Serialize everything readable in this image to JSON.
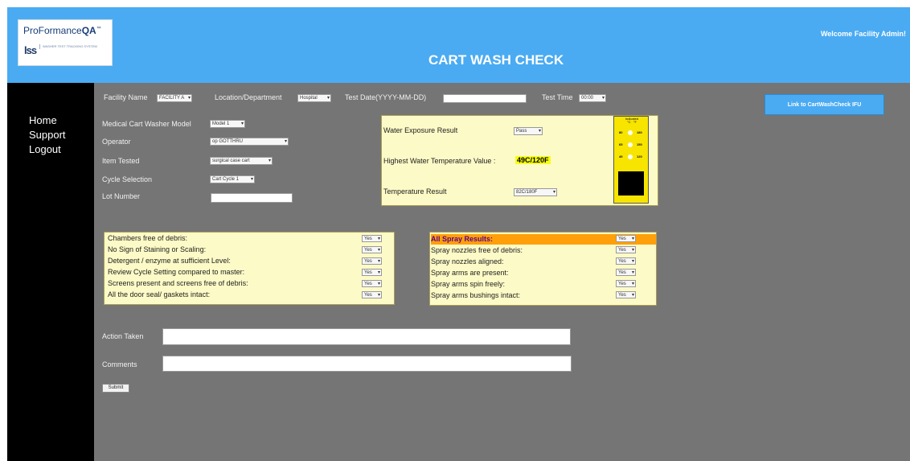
{
  "header": {
    "logo_brand_plain": "ProFormance",
    "logo_brand_bold": "QA",
    "logo_tm": "™",
    "logo_mark": "lss",
    "logo_sub": "WASHER TEST TRACKING SYSTEM",
    "title": "CART WASH CHECK",
    "welcome": "Welcome Facility Admin!"
  },
  "nav": [
    "Home",
    "Support",
    "Logout"
  ],
  "link_button": "Link to CartWashCheck IFU",
  "top_fields": {
    "facility_label": "Facility Name",
    "facility_value": "FACILITY A",
    "location_label": "Location/Department",
    "location_value": "Hospital",
    "date_label": "Test Date(YYYY-MM-DD)",
    "date_value": "",
    "time_label": "Test Time",
    "time_value": "00:00"
  },
  "left_fields": {
    "model_label": "Medical Cart Washer Model",
    "model_value": "Model 1",
    "operator_label": "Operator",
    "operator_value": "op GOTTHRU",
    "item_label": "Item Tested",
    "item_value": "surgical case cart",
    "cycle_label": "Cycle Selection",
    "cycle_value": "Cart Cycle 1",
    "lot_label": "Lot Number",
    "lot_value": ""
  },
  "water_panel": {
    "exposure_label": "Water Exposure Result",
    "exposure_value": "Pass",
    "temp_label": "Highest Water Temperature Value :",
    "temp_value": "49C/120F",
    "temp_result_label": "Temperature Result",
    "temp_result_value": "82C/180F",
    "gauge_header": "Indicated\n°C   °F",
    "gauge_rows": [
      {
        "c": "80",
        "f": "180"
      },
      {
        "c": "65",
        "f": "150"
      },
      {
        "c": "49",
        "f": "120"
      }
    ]
  },
  "checklist": [
    {
      "label": "Chambers free of debris:",
      "value": "Yes"
    },
    {
      "label": "No Sign of Staining or Scaling:",
      "value": "Yes"
    },
    {
      "label": "Detergent / enzyme at sufficient Level:",
      "value": "Yes"
    },
    {
      "label": "Review Cycle Setting compared to master:",
      "value": "Yes"
    },
    {
      "label": "Screens present and screens free of debris:",
      "value": "Yes"
    },
    {
      "label": "All the door seal/ gaskets intact:",
      "value": "Yes"
    }
  ],
  "spray": {
    "header_label": "All Spray Results:",
    "header_value": "Yes",
    "items": [
      {
        "label": "Spray nozzles free of debris:",
        "value": "Yes"
      },
      {
        "label": "Spray nozzles aligned:",
        "value": "Yes"
      },
      {
        "label": "Spray arms are present:",
        "value": "Yes"
      },
      {
        "label": "Spray arms spin freely:",
        "value": "Yes"
      },
      {
        "label": "Spray arms bushings intact:",
        "value": "Yes"
      }
    ]
  },
  "action_label": "Action Taken",
  "comments_label": "Comments",
  "save_label": "Submit",
  "colors": {
    "header_blue": "#4aabf2",
    "body_gray": "#757575",
    "panel_yellow": "#fcfac6",
    "highlight_yellow": "#f8ff14",
    "gauge_yellow": "#f7e500",
    "spray_orange": "#ffa00a"
  }
}
